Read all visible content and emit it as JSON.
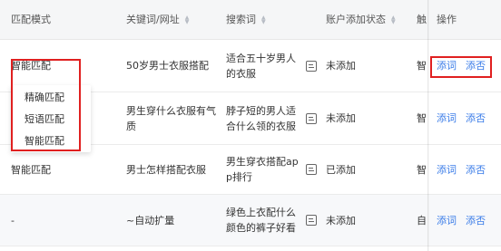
{
  "table": {
    "headers": {
      "mode": "匹配模式",
      "keyword": "关键词/网址",
      "search_term": "搜索词",
      "status": "账户添加状态",
      "trigger": "触",
      "operation": "操作"
    },
    "rows": [
      {
        "mode": "智能匹配",
        "keyword": "50岁男士衣服搭配",
        "term_line1": "适合五十岁男人",
        "term_line2": "的衣服",
        "status": "未添加",
        "trigger": "智",
        "op_add": "添词",
        "op_negate": "添否"
      },
      {
        "mode": "",
        "keyword_line1": "男生穿什么衣服有气",
        "keyword_line2": "质",
        "term_line1": "脖子短的男人适",
        "term_line2": "合什么领的衣服",
        "status": "未添加",
        "trigger": "智",
        "op_add": "添词",
        "op_negate": "添否"
      },
      {
        "mode": "智能匹配",
        "keyword": "男士怎样搭配衣服",
        "term_line1": "男生穿衣搭配ap",
        "term_line2": "p排行",
        "status": "已添加",
        "trigger": "智",
        "op_add": "添词",
        "op_negate": "添否"
      },
      {
        "mode": "-",
        "keyword": "~自动扩量",
        "term_line1": "绿色上衣配什么",
        "term_line2": "颜色的裤子好看",
        "status": "未添加",
        "trigger": "自",
        "op_add": "添词",
        "op_negate": "添否"
      }
    ]
  },
  "dropdown": {
    "options": [
      "精确匹配",
      "短语匹配",
      "智能匹配"
    ]
  },
  "colors": {
    "link": "#3a7ce8",
    "highlight": "#e02020",
    "header_bg": "#f5f6f7"
  },
  "icons": [
    "sort-icon",
    "edit-icon"
  ]
}
